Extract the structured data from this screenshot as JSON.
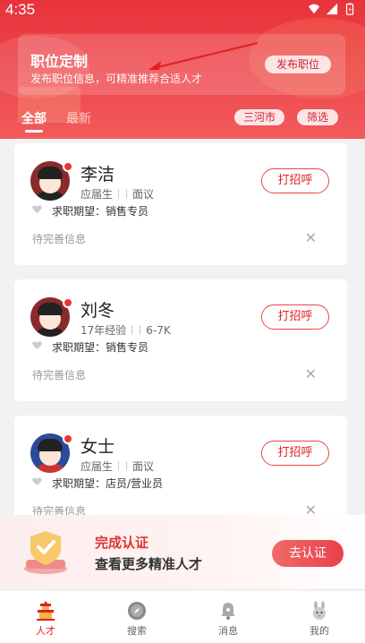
{
  "status_bar": {
    "time": "4:35"
  },
  "header": {
    "card_title": "职位定制",
    "card_subtitle": "发布职位信息，可精准推荐合适人才",
    "publish_label": "发布职位",
    "tabs": [
      {
        "label": "全部",
        "active": true
      },
      {
        "label": "最新",
        "active": false
      }
    ],
    "city_filter": "三河市",
    "filter_label": "筛选"
  },
  "candidates": [
    {
      "name": "李洁",
      "meta1": "应届生",
      "meta2": "面议",
      "expectation": "求职期望：销售专员",
      "status": "待完善信息",
      "greet_label": "打招呼",
      "avatar_color": "#8b2a2a"
    },
    {
      "name": "刘冬",
      "meta1": "17年经验",
      "meta2": "6-7K",
      "expectation": "求职期望：销售专员",
      "status": "待完善信息",
      "greet_label": "打招呼",
      "avatar_color": "#8b2a2a"
    },
    {
      "name": "女士",
      "meta1": "应届生",
      "meta2": "面议",
      "expectation": "求职期望：店员/营业员",
      "status": "待完善信息",
      "greet_label": "打招呼",
      "avatar_color": "#2a4a9a"
    }
  ],
  "certify_banner": {
    "title": "完成认证",
    "subtitle": "查看更多精准人才",
    "button_label": "去认证"
  },
  "bottom_nav": [
    {
      "label": "人才",
      "icon": "temple-icon",
      "active": true
    },
    {
      "label": "搜索",
      "icon": "compass-icon",
      "active": false
    },
    {
      "label": "消息",
      "icon": "bell-icon",
      "active": false
    },
    {
      "label": "我的",
      "icon": "rabbit-icon",
      "active": false
    }
  ],
  "colors": {
    "primary": "#e8323a",
    "accent_text": "#d22222"
  }
}
